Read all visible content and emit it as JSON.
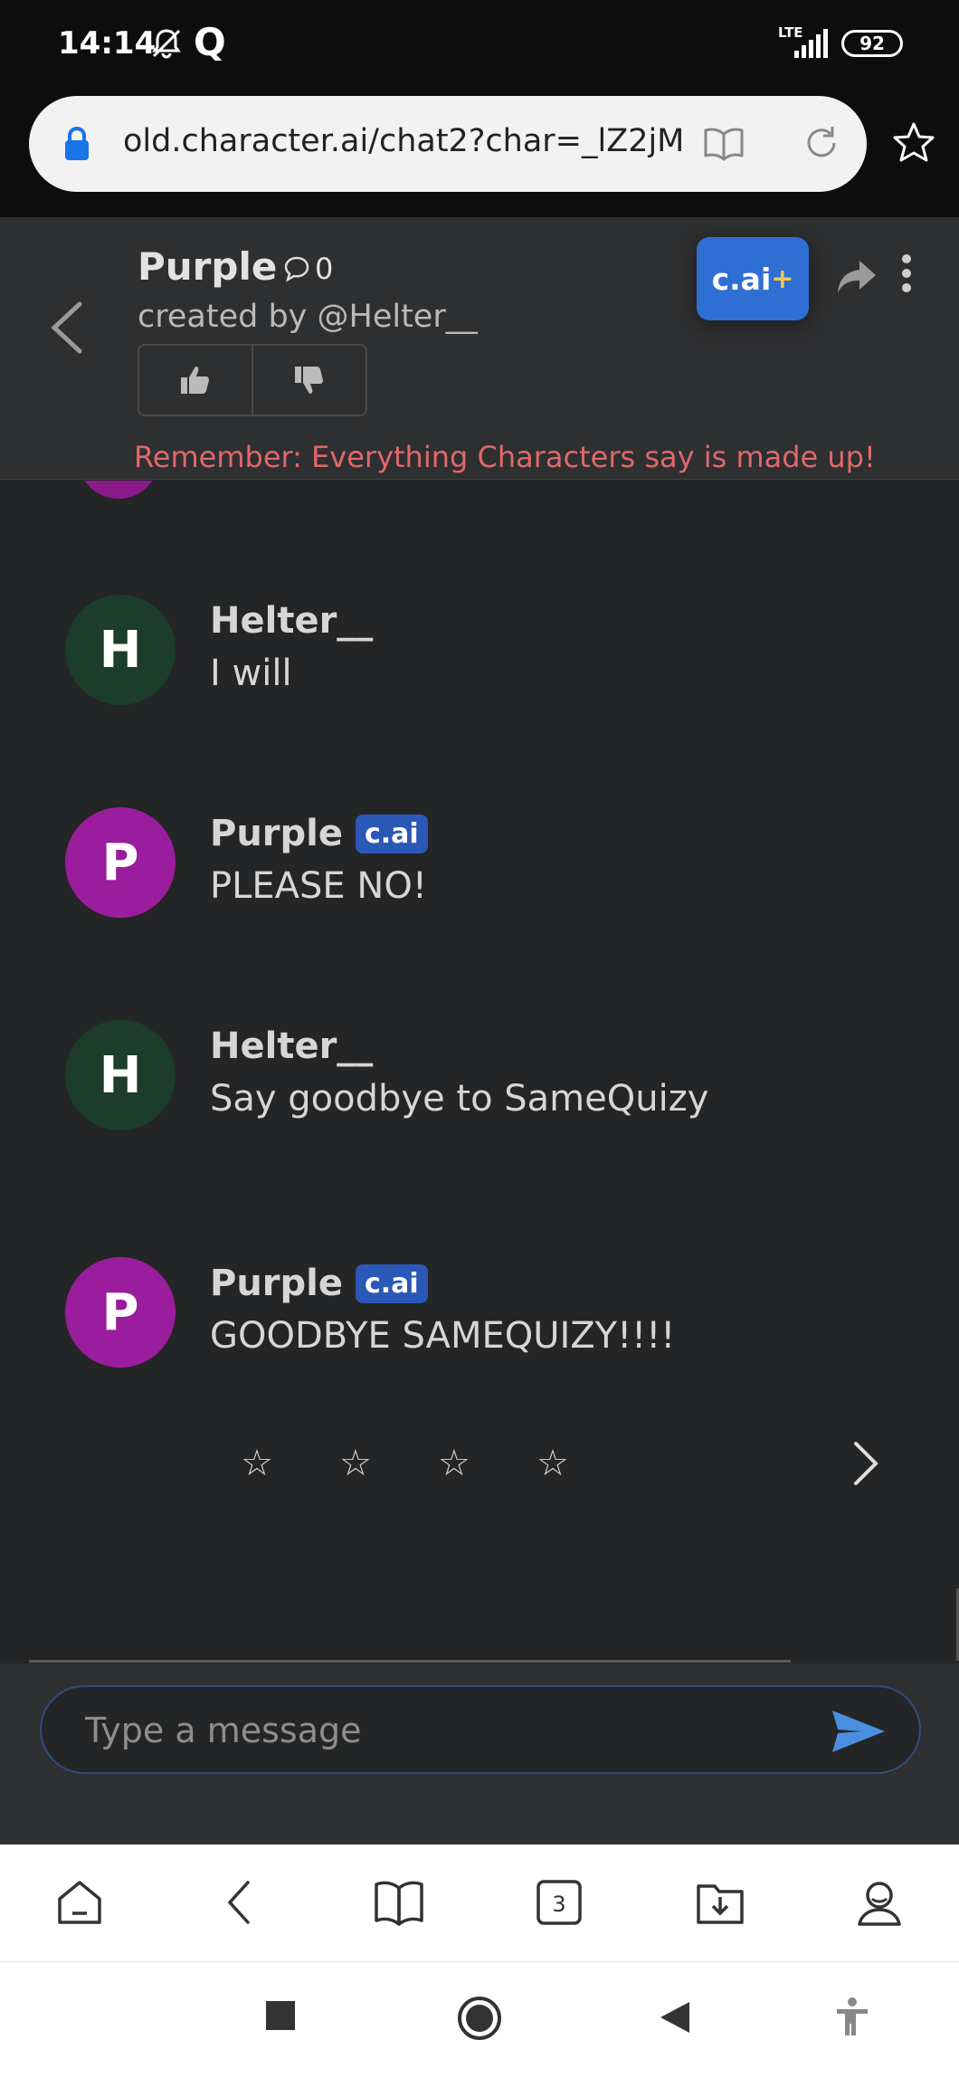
{
  "status_bar": {
    "time": "14:14",
    "q_label": "Q",
    "network": "LTE",
    "battery": "92"
  },
  "browser": {
    "url": "old.character.ai/chat2?char=_lZ2jM",
    "icons": [
      "lock-icon",
      "reader-mode-icon",
      "reload-icon",
      "star-icon"
    ]
  },
  "header": {
    "character_name": "Purple",
    "chat_count": "0",
    "creator": "created by @Helter__",
    "cai_plus_label": "c.ai",
    "cai_plus_symbol": "+",
    "disclaimer": "Remember: Everything Characters say is made up!"
  },
  "messages": [
    {
      "sender": "Helter__",
      "initial": "H",
      "text": "I will",
      "is_character": false
    },
    {
      "sender": "Purple",
      "initial": "P",
      "text": "PLEASE NO!",
      "is_character": true,
      "badge": "c.ai"
    },
    {
      "sender": "Helter__",
      "initial": "H",
      "text": "Say goodbye to SameQuizy",
      "is_character": false
    },
    {
      "sender": "Purple",
      "initial": "P",
      "text": "GOODBYE SAMEQUIZY!!!!",
      "is_character": true,
      "badge": "c.ai"
    }
  ],
  "rating": {
    "stars": [
      "☆",
      "☆",
      "☆",
      "☆"
    ]
  },
  "composer": {
    "placeholder": "Type a message"
  },
  "toolbar": {
    "tab_count": "3"
  },
  "colors": {
    "accent": "#2f6fd3",
    "character_avatar": "#9a1d9d",
    "user_avatar": "#1c3c2c",
    "disclaimer": "#e0686a"
  }
}
